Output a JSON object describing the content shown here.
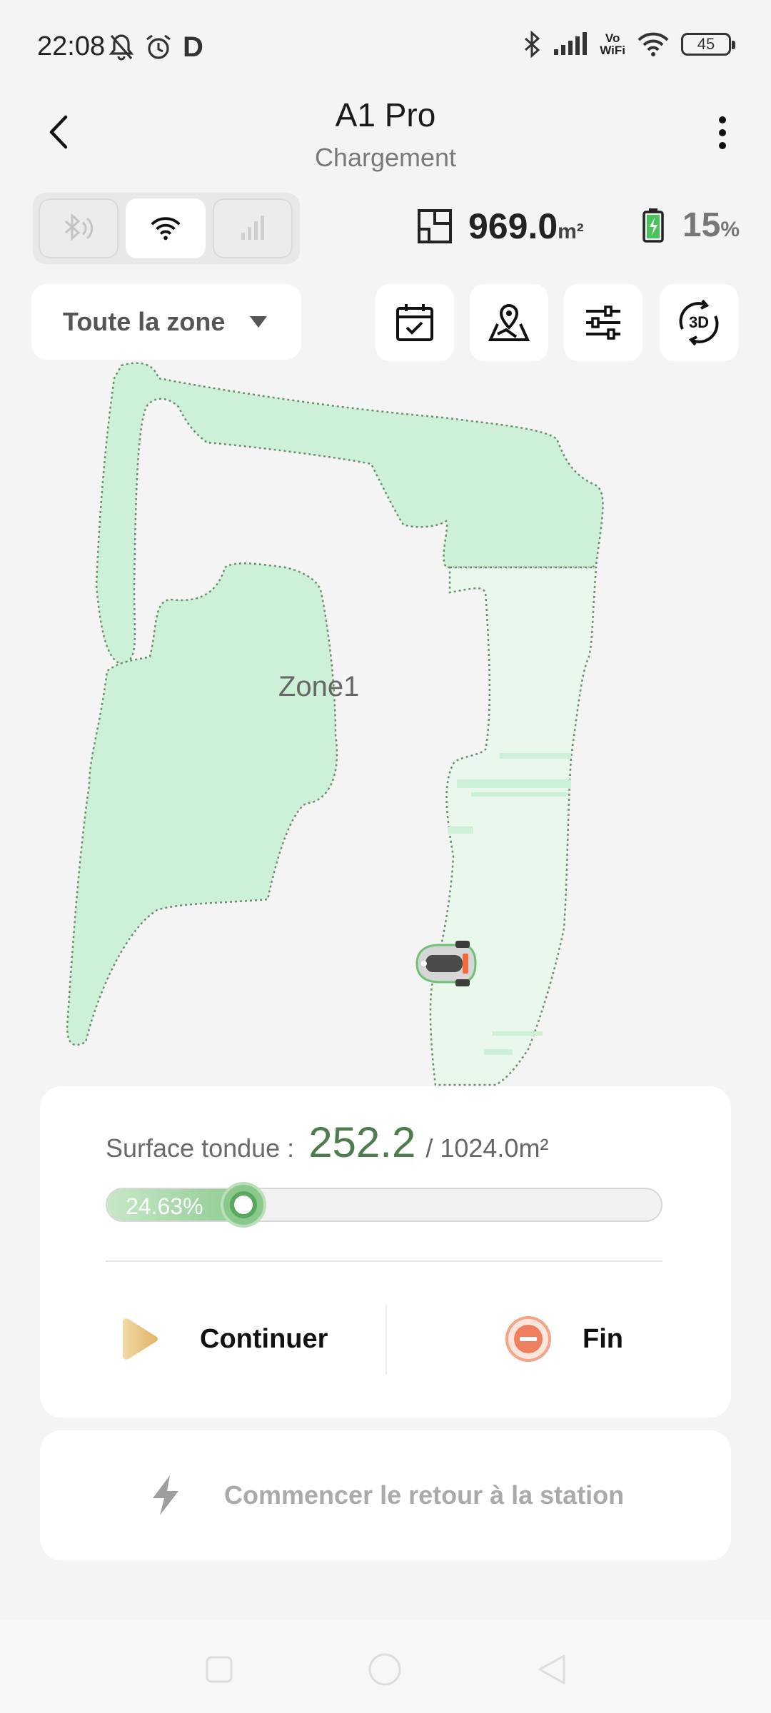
{
  "status_bar": {
    "time": "22:08",
    "left_icons": [
      "bell-off-icon",
      "alarm-icon",
      "d-app-icon"
    ],
    "d_letter": "D",
    "vowifi_top": "Vo",
    "vowifi_bottom": "WiFi",
    "battery": "45"
  },
  "header": {
    "title": "A1 Pro",
    "subtitle": "Chargement"
  },
  "connectivity": {
    "options": [
      "bluetooth-icon",
      "wifi-icon",
      "cellular-icon"
    ],
    "active": "wifi-icon"
  },
  "stats": {
    "area_value": "969.0",
    "area_unit": "m²",
    "battery_value": "15",
    "battery_unit": "%"
  },
  "toolbar": {
    "zone_selector": "Toute la zone",
    "tools": [
      "schedule-icon",
      "map-edit-icon",
      "settings-sliders-icon",
      "3d-view-icon"
    ],
    "view_3d_label": "3D"
  },
  "map": {
    "zone_label": "Zone1",
    "colors": {
      "zone_fill": "#cdf0d9",
      "mowed_fill": "#e9f7ed",
      "border": "#6e8f6f"
    }
  },
  "progress": {
    "label": "Surface tondue :",
    "mowed_value": "252.2",
    "total": "/ 1024.0m²",
    "percent_text": "24.63%",
    "fraction": 0.2463,
    "continue_label": "Continuer",
    "end_label": "Fin"
  },
  "return_station": {
    "label": "Commencer le retour à la station"
  },
  "colors": {
    "accent_green": "#4e7c4e",
    "continue_gold": "#e7c27a",
    "end_orange": "#f07f5f"
  }
}
